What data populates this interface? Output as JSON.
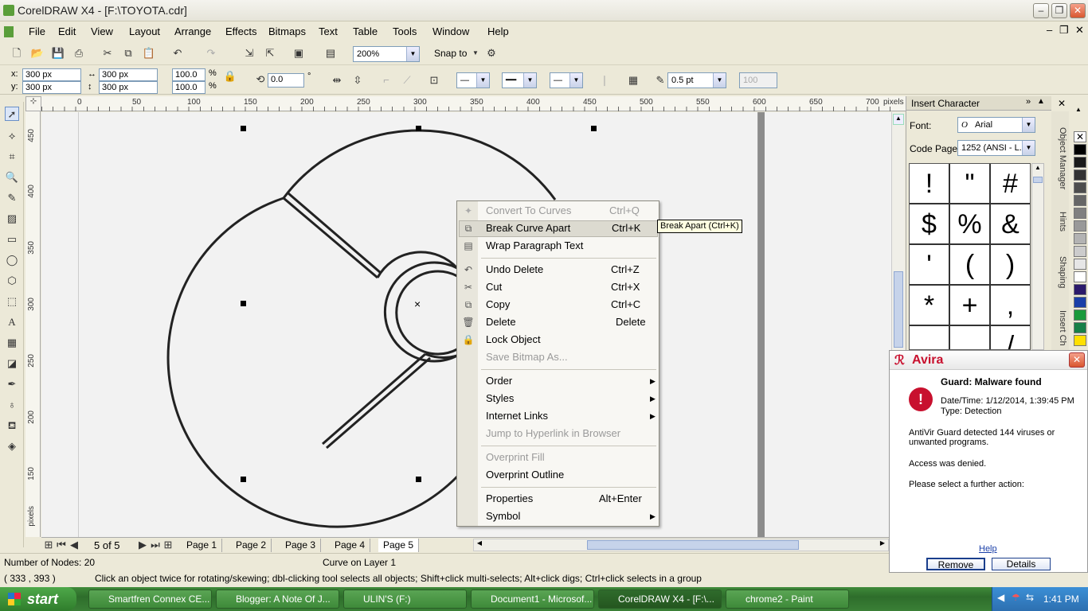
{
  "window": {
    "title": "CorelDRAW X4 - [F:\\TOYOTA.cdr]"
  },
  "menu": [
    "File",
    "Edit",
    "View",
    "Layout",
    "Arrange",
    "Effects",
    "Bitmaps",
    "Text",
    "Table",
    "Tools",
    "Window",
    "Help"
  ],
  "toolbar": {
    "zoom": "200%",
    "snap_label": "Snap to"
  },
  "props": {
    "x": "300 px",
    "y": "300 px",
    "w": "300 px",
    "h": "300 px",
    "sx": "100.0",
    "sy": "100.0",
    "pct": "%",
    "angle": "0.0",
    "deg": "°",
    "outline": "0.5 pt",
    "opacity": "100"
  },
  "rulers": {
    "h": [
      "0",
      "50",
      "100",
      "150",
      "200",
      "250",
      "300",
      "350",
      "400",
      "450",
      "500",
      "550",
      "600",
      "650",
      "700"
    ],
    "unit": "pixels",
    "v": [
      "450",
      "400",
      "350",
      "300",
      "250",
      "200",
      "150"
    ]
  },
  "pages": {
    "counter": "5 of 5",
    "tabs": [
      "Page 1",
      "Page 2",
      "Page 3",
      "Page 4",
      "Page 5"
    ]
  },
  "status": {
    "nodes": "Number of Nodes: 20",
    "layer": "Curve on Layer 1",
    "coords": "( 333 , 393 )",
    "hint": "Click an object twice for rotating/skewing; dbl-clicking tool selects all objects; Shift+click multi-selects; Alt+click digs; Ctrl+click selects in a group"
  },
  "docker": {
    "title": "Insert Character",
    "font_label": "Font:",
    "font": "Arial",
    "codepage_label": "Code Page:",
    "codepage": "1252  (ANSI - L...",
    "chars": [
      "!",
      "\"",
      "#",
      "$",
      "%",
      "&",
      "'",
      "(",
      ")",
      "*",
      "+",
      ",",
      "",
      "",
      "/"
    ]
  },
  "vtabs": [
    "Object Manager",
    "Hints",
    "Shaping",
    "Insert Ch"
  ],
  "context_menu": {
    "items": [
      {
        "label": "Convert To Curves",
        "shortcut": "Ctrl+Q",
        "disabled": true
      },
      {
        "label": "Break Curve Apart",
        "shortcut": "Ctrl+K",
        "disabled": false
      },
      {
        "label": "Wrap Paragraph Text",
        "shortcut": "",
        "disabled": false
      },
      {
        "label": "Undo Delete",
        "shortcut": "Ctrl+Z",
        "disabled": false
      },
      {
        "label": "Cut",
        "shortcut": "Ctrl+X",
        "disabled": false
      },
      {
        "label": "Copy",
        "shortcut": "Ctrl+C",
        "disabled": false
      },
      {
        "label": "Delete",
        "shortcut": "Delete",
        "disabled": false
      },
      {
        "label": "Lock Object",
        "shortcut": "",
        "disabled": false
      },
      {
        "label": "Save Bitmap As...",
        "shortcut": "",
        "disabled": true
      },
      {
        "label": "Order",
        "shortcut": "",
        "disabled": false
      },
      {
        "label": "Styles",
        "shortcut": "",
        "disabled": false
      },
      {
        "label": "Internet Links",
        "shortcut": "",
        "disabled": false
      },
      {
        "label": "Jump to Hyperlink in Browser",
        "shortcut": "",
        "disabled": true
      },
      {
        "label": "Overprint Fill",
        "shortcut": "",
        "disabled": true
      },
      {
        "label": "Overprint Outline",
        "shortcut": "",
        "disabled": false
      },
      {
        "label": "Properties",
        "shortcut": "Alt+Enter",
        "disabled": false
      },
      {
        "label": "Symbol",
        "shortcut": "",
        "disabled": false
      }
    ],
    "tooltip": "Break Apart (Ctrl+K)"
  },
  "avira": {
    "brand": "Avira",
    "heading": "Guard: Malware found",
    "datetime": "Date/Time: 1/12/2014, 1:39:45 PM",
    "type": "Type: Detection",
    "detected": "AntiVir Guard detected 144 viruses or unwanted programs.",
    "denied": "Access was denied.",
    "select": "Please select a further action:",
    "help": "Help",
    "remove": "Remove",
    "details": "Details"
  },
  "taskbar": {
    "start": "start",
    "items": [
      "Smartfren Connex CE...",
      "Blogger: A Note Of J...",
      "ULIN'S (F:)",
      "Document1 - Microsof...",
      "CorelDRAW X4 - [F:\\...",
      "chrome2 - Paint"
    ],
    "clock": "1:41 PM"
  },
  "colors": {
    "accent_red": "#c8102e",
    "palette": [
      "#ffffff",
      "#000000",
      "#1a1a1a",
      "#333333",
      "#4d4d4d",
      "#666666",
      "#808080",
      "#999999",
      "#b3b3b3",
      "#cccccc",
      "#e6e6e6",
      "#ffffff",
      "#2b1a6b",
      "#1a3fa8",
      "#1f7fd8",
      "#1a9a3a",
      "#ffe000"
    ]
  }
}
